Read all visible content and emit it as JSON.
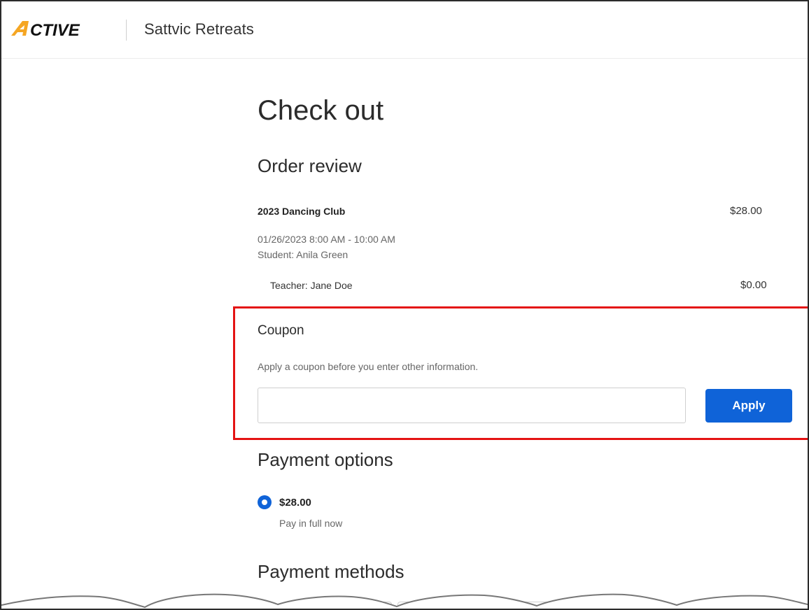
{
  "header": {
    "logo_text": "ACTIVE",
    "site_name": "Sattvic Retreats"
  },
  "checkout": {
    "page_title": "Check out",
    "order_review": {
      "title": "Order review",
      "item_name": "2023 Dancing Club",
      "item_price": "$28.00",
      "datetime": "01/26/2023 8:00 AM - 10:00 AM",
      "student": "Student: Anila Green",
      "teacher": "Teacher: Jane Doe",
      "teacher_price": "$0.00"
    },
    "coupon": {
      "title": "Coupon",
      "help_text": "Apply a coupon before you enter other information.",
      "input_value": "",
      "input_placeholder": "",
      "apply_label": "Apply"
    },
    "payment_options": {
      "title": "Payment options",
      "selected_amount": "$28.00",
      "selected_description": "Pay in full now"
    },
    "payment_methods": {
      "title": "Payment methods"
    }
  },
  "colors": {
    "accent": "#0f63d8",
    "highlight": "#e41313",
    "logo_orange": "#f5a623"
  },
  "icons": {
    "radio": "radio-selected-icon"
  }
}
